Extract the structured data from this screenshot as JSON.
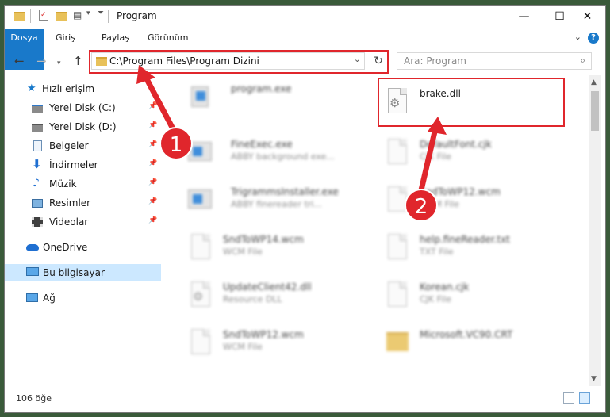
{
  "window": {
    "title": "Program",
    "controls": {
      "minimize": "—",
      "maximize": "☐",
      "close": "✕"
    }
  },
  "ribbon": {
    "tabs": [
      {
        "label": "Dosya",
        "active": true
      },
      {
        "label": "Giriş"
      },
      {
        "label": "Paylaş"
      },
      {
        "label": "Görünüm"
      }
    ],
    "help": "?"
  },
  "address": {
    "path": "C:\\Program Files\\Program Dizini",
    "search_placeholder": "Ara: Program"
  },
  "sidebar": {
    "items": [
      {
        "label": "Hızlı erişim",
        "icon": "star-icon",
        "pinned": false
      },
      {
        "label": "Yerel Disk (C:)",
        "icon": "drive-icon",
        "pinned": true
      },
      {
        "label": "Yerel Disk (D:)",
        "icon": "drive-icon",
        "pinned": true
      },
      {
        "label": "Belgeler",
        "icon": "documents-icon",
        "pinned": true
      },
      {
        "label": "İndirmeler",
        "icon": "download-icon",
        "pinned": true
      },
      {
        "label": "Müzik",
        "icon": "music-icon",
        "pinned": true
      },
      {
        "label": "Resimler",
        "icon": "pictures-icon",
        "pinned": true
      },
      {
        "label": "Videolar",
        "icon": "video-icon",
        "pinned": true
      },
      {
        "label": "OneDrive",
        "icon": "cloud-icon",
        "pinned": false
      },
      {
        "label": "Bu bilgisayar",
        "icon": "computer-icon",
        "pinned": false,
        "selected": true
      },
      {
        "label": "Ağ",
        "icon": "network-icon",
        "pinned": false
      }
    ]
  },
  "files": [
    {
      "name": "program.exe",
      "type": "",
      "icon": "installer-icon",
      "blurred": true
    },
    {
      "name": "brake.dll",
      "type": "",
      "icon": "dll-gear-icon",
      "blurred": false,
      "highlighted": true
    },
    {
      "name": "FineExec.exe",
      "type": "ABBY background exe...",
      "icon": "app-window-icon",
      "blurred": true
    },
    {
      "name": "DefaultFont.cjk",
      "type": "CJK File",
      "icon": "file-icon",
      "blurred": true
    },
    {
      "name": "TrigrammsInstaller.exe",
      "type": "ABBY finereader tri...",
      "icon": "app-window-icon",
      "blurred": true
    },
    {
      "name": "SndToWP12.wcm",
      "type": "WCM File",
      "icon": "file-icon",
      "blurred": true
    },
    {
      "name": "SndToWP14.wcm",
      "type": "WCM File",
      "icon": "file-icon",
      "blurred": true
    },
    {
      "name": "help.fineReader.txt",
      "type": "TXT File",
      "icon": "text-file-icon",
      "blurred": true
    },
    {
      "name": "UpdateClient42.dll",
      "type": "Resource DLL",
      "icon": "dll-gear-icon",
      "blurred": true
    },
    {
      "name": "Korean.cjk",
      "type": "CJK File",
      "icon": "file-icon",
      "blurred": true
    },
    {
      "name": "SndToWP12.wcm",
      "type": "WCM File",
      "icon": "file-icon",
      "blurred": true
    },
    {
      "name": "Microsoft.VC90.CRT",
      "type": "",
      "icon": "folder-icon",
      "blurred": true
    }
  ],
  "status": {
    "item_count": "106 öğe"
  },
  "callouts": [
    "1",
    "2"
  ],
  "colors": {
    "accent": "#1979ca",
    "highlight": "#e0262c",
    "selection": "#cce8ff"
  }
}
